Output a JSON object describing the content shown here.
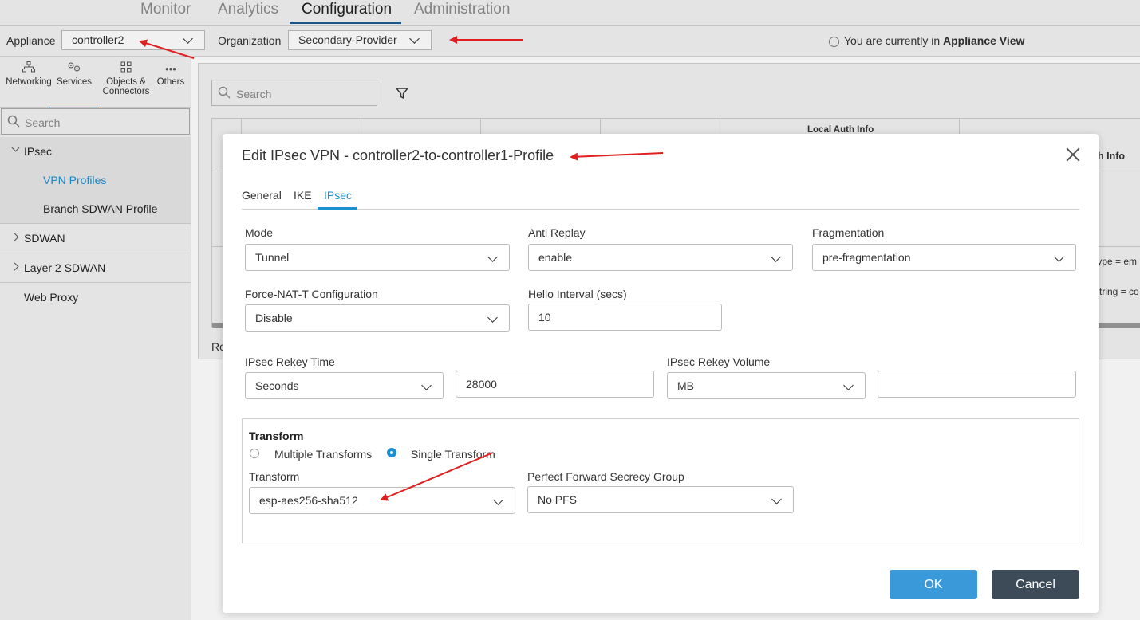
{
  "topnav": {
    "tabs": [
      "Monitor",
      "Analytics",
      "Configuration",
      "Administration"
    ],
    "active": "Configuration"
  },
  "toolbar": {
    "appliance_label": "Appliance",
    "appliance_value": "controller2",
    "organization_label": "Organization",
    "organization_value": "Secondary-Provider",
    "info_prefix": "You are currently in",
    "info_view": "Appliance View"
  },
  "sidebar": {
    "icons": [
      {
        "label": "Networking",
        "icon": "network-icon"
      },
      {
        "label": "Services",
        "icon": "services-gear-icon"
      },
      {
        "label_line1": "Objects &",
        "label_line2": "Connectors",
        "icon": "objects-grid-icon"
      },
      {
        "label": "Others",
        "icon": "more-dots-icon"
      }
    ],
    "search_placeholder": "Search",
    "tree": {
      "ipsec": "IPsec",
      "vpn_profiles": "VPN Profiles",
      "branch_sdwan": "Branch SDWAN Profile",
      "sdwan": "SDWAN",
      "layer2": "Layer 2 SDWAN",
      "web_proxy": "Web Proxy"
    }
  },
  "background": {
    "search_placeholder": "Search",
    "col_local_auth": "Local Auth Info",
    "col_peer_auth_fragment": "h Info",
    "row_text_1": "type = em",
    "row_text_2": "string = co",
    "footer_fragment": "Ro"
  },
  "modal": {
    "title": "Edit IPsec VPN - controller2-to-controller1-Profile",
    "tabs": [
      "General",
      "IKE",
      "IPsec"
    ],
    "active_tab": "IPsec",
    "fields": {
      "mode_label": "Mode",
      "mode_value": "Tunnel",
      "anti_replay_label": "Anti Replay",
      "anti_replay_value": "enable",
      "fragmentation_label": "Fragmentation",
      "fragmentation_value": "pre-fragmentation",
      "force_nat_label": "Force-NAT-T Configuration",
      "force_nat_value": "Disable",
      "hello_label": "Hello Interval (secs)",
      "hello_value": "10",
      "rekey_time_label": "IPsec Rekey Time",
      "rekey_time_unit": "Seconds",
      "rekey_time_value": "28000",
      "rekey_volume_label": "IPsec Rekey Volume",
      "rekey_volume_unit": "MB",
      "rekey_volume_value": ""
    },
    "transform": {
      "heading": "Transform",
      "radio_multiple": "Multiple Transforms",
      "radio_single": "Single Transform",
      "selected": "Single Transform",
      "transform_label": "Transform",
      "transform_value": "esp-aes256-sha512",
      "pfs_label": "Perfect Forward Secrecy Group",
      "pfs_value": "No PFS"
    },
    "buttons": {
      "ok": "OK",
      "cancel": "Cancel"
    }
  },
  "colors": {
    "accent": "#1a8fd1",
    "ok_button": "#3a9ad9",
    "cancel_button": "#3d4a57",
    "annotation_arrow": "#e02020"
  }
}
